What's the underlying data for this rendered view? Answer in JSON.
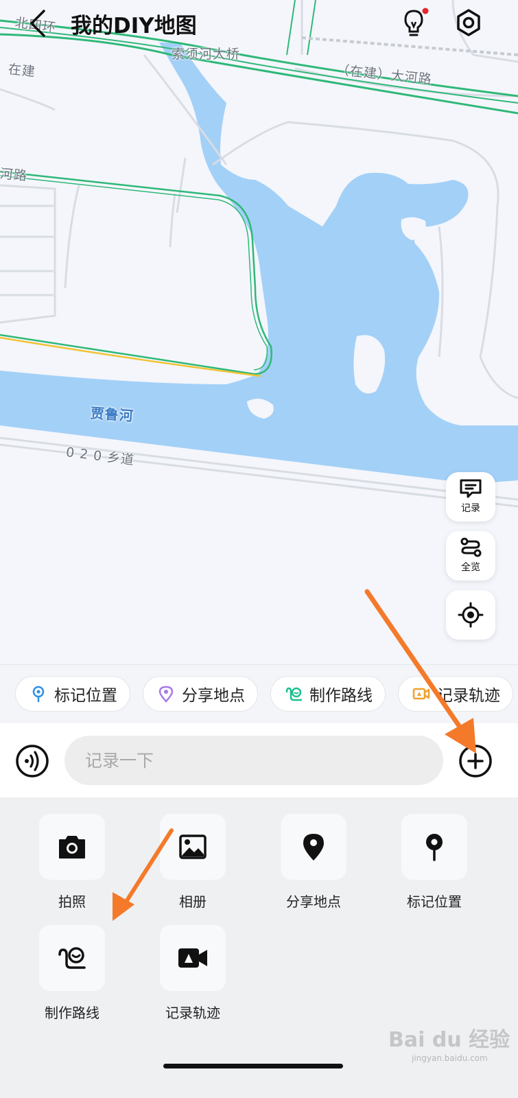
{
  "header": {
    "title": "我的DIY地图"
  },
  "map": {
    "labels": {
      "ring_road": "北四环",
      "under_construction": "在建",
      "bridge": "索须河大桥",
      "dahe_road": "（在建）大河路",
      "road_left": "河路",
      "river": "贾鲁河",
      "village_road": "0 2 0 乡道"
    },
    "colors": {
      "water": "#a3d0f7",
      "road_green": "#2fb878",
      "road_yellow": "#f1c232",
      "land": "#f4f6fb"
    }
  },
  "side_buttons": {
    "record": {
      "label": "记录",
      "icon": "message-icon"
    },
    "overview": {
      "label": "全览",
      "icon": "route-icon"
    },
    "locate": {
      "icon": "locate-icon"
    }
  },
  "chips": [
    {
      "label": "标记位置",
      "icon": "pin-icon",
      "color": "#2b8fe8"
    },
    {
      "label": "分享地点",
      "icon": "location-icon",
      "color": "#a779e8"
    },
    {
      "label": "制作路线",
      "icon": "route-make-icon",
      "color": "#1dbf8f"
    },
    {
      "label": "记录轨迹",
      "icon": "video-icon",
      "color": "#f2a12b"
    }
  ],
  "composer": {
    "placeholder": "记录一下"
  },
  "tools": [
    {
      "label": "拍照",
      "icon": "camera-icon"
    },
    {
      "label": "相册",
      "icon": "photo-icon"
    },
    {
      "label": "分享地点",
      "icon": "location-icon"
    },
    {
      "label": "标记位置",
      "icon": "pin-icon"
    },
    {
      "label": "制作路线",
      "icon": "route-make-icon"
    },
    {
      "label": "记录轨迹",
      "icon": "video-icon"
    }
  ],
  "watermark": {
    "brand": "Bai du 经验",
    "site": "jingyan.baidu.com"
  },
  "annotation_color": "#f47a2a"
}
